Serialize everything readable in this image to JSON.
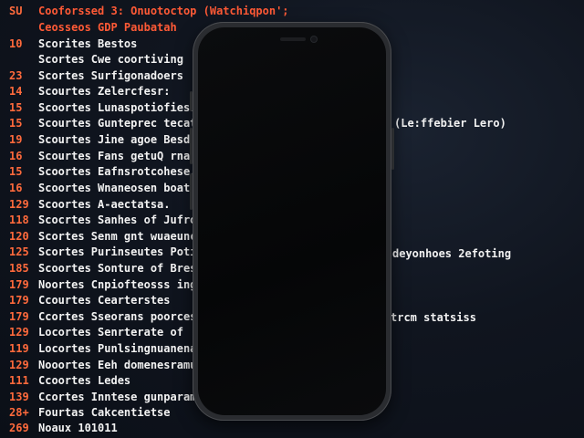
{
  "terminal": {
    "header": {
      "num": "SU",
      "text": "Cooforssed 3: Onuotoctop (Watchiqpon';"
    },
    "sub_header": {
      "text": "Ceosseos GDP Paubatah"
    },
    "lines": [
      {
        "num": "10",
        "text": "Scorites Bestos"
      },
      {
        "num": "",
        "text": "Scortes Cwe coortiving"
      },
      {
        "num": "23",
        "text": "Scortes Surfigonadoers"
      },
      {
        "num": "14",
        "text": "Scourtes Zelercfesr:"
      },
      {
        "num": "15",
        "text": "Scoortes Lunaspotiofiesn"
      },
      {
        "num": "15",
        "text": "Scourtes Gunteprec tecat"
      },
      {
        "num": "19",
        "text": "Scourtes Jine agoe Besdis"
      },
      {
        "num": "16",
        "text": "Scourtes Fans getuQ rnaoo"
      },
      {
        "num": "15",
        "text": "Scoortes Eafnsrotcohese."
      },
      {
        "num": "16",
        "text": "Scoortes Wnaneosen boatst"
      },
      {
        "num": "129",
        "text": "Scoortes A-aectatsa."
      },
      {
        "num": "118",
        "text": "Scocrtes Sanhes of Jufrona"
      },
      {
        "num": "120",
        "text": "Scortes Senm gnt wuaeunc"
      },
      {
        "num": "125",
        "text": "Scortes Purinseutes Potiouo"
      },
      {
        "num": "185",
        "text": "Scoortes Sonture of Brescer"
      },
      {
        "num": "179",
        "text": "Noortes Cnpiofteosss ingie"
      },
      {
        "num": "179",
        "text": "Ccourtes Cearterstes"
      },
      {
        "num": "179",
        "text": "Ccortes Sseorans poorcess"
      },
      {
        "num": "129",
        "text": "Locortes Senrterate of"
      },
      {
        "num": "119",
        "text": "Locortes Punlsingnuanenaeg"
      },
      {
        "num": "129",
        "text": "Nooortes Eeh domenesramusn"
      },
      {
        "num": "111",
        "text": "Ccoortes Ledes"
      },
      {
        "num": "139",
        "text": "Ccortes Inntese gunparam"
      },
      {
        "num": "28+",
        "text": "Fourtas Cakcentietse"
      },
      {
        "num": "269",
        "text": "Noaux 101011"
      }
    ],
    "right_texts": [
      {
        "text": "(Le:ffebier Lero)"
      },
      {
        "text": "deyonhoes 2efoting"
      },
      {
        "text": "trcm statsiss"
      }
    ]
  },
  "colors": {
    "background": "#10151f",
    "line_numbers": "#ff6a3c",
    "header_accent": "#ff5a36",
    "text": "#f2f2f2",
    "phone_body": "#2a2c30",
    "phone_screen": "#050607"
  }
}
